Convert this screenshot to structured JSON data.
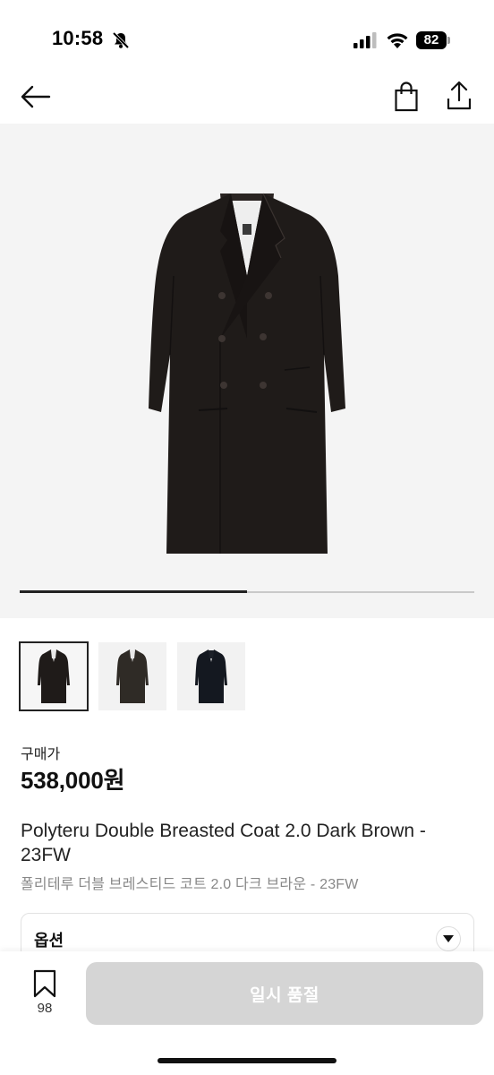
{
  "status_bar": {
    "time": "10:58",
    "battery": "82",
    "icons": [
      "bell-slash-icon",
      "signal-icon",
      "wifi-icon",
      "battery-icon"
    ]
  },
  "nav": {
    "icons": [
      "back-arrow-icon",
      "shopping-bag-icon",
      "share-icon"
    ]
  },
  "gallery": {
    "image_count": 2,
    "current_index": 1,
    "progress_fraction": 0.5,
    "thumbnails": [
      {
        "selected": true
      },
      {
        "selected": false
      },
      {
        "selected": false
      }
    ]
  },
  "product": {
    "price_label": "구매가",
    "price": "538,000원",
    "title": "Polyteru Double Breasted Coat 2.0 Dark Brown - 23FW",
    "subtitle": "폴리테루 더블 브레스티드 코트 2.0 다크 브라운 - 23FW"
  },
  "option": {
    "label": "옵션"
  },
  "bottom_bar": {
    "bookmark_count": "98",
    "action_label": "일시 품절"
  },
  "colors": {
    "coat": "#1f1b19",
    "disabled_button": "#d5d5d5",
    "image_bg": "#f4f4f4"
  }
}
